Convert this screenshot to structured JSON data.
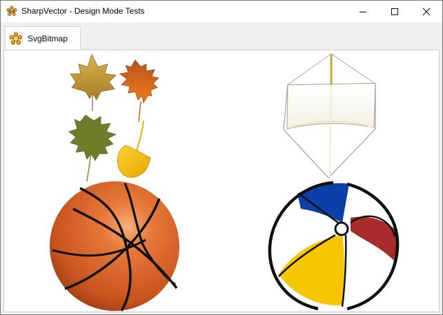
{
  "window": {
    "title": "SharpVector - Design Mode Tests",
    "title_icon": "svg-logo-icon",
    "controls": [
      "minimize-icon",
      "maximize-icon",
      "close-icon"
    ]
  },
  "tabs": [
    {
      "label": "SvgBitmap",
      "icon": "svg-logo-icon",
      "selected": true
    }
  ],
  "drawing": {
    "items": [
      "maple-leaf",
      "orange-oak-leaf",
      "green-oak-leaf",
      "yellow-leaf",
      "kite",
      "basketball",
      "beach-ball"
    ]
  },
  "colors": {
    "basketball": "#d8662a",
    "beach_blue": "#0c3fa8",
    "beach_red": "#a72b2b",
    "beach_yellow": "#f6c700",
    "leaf_gold": "#c9a13a",
    "leaf_orange": "#d6631d",
    "leaf_green": "#6f7d2a",
    "leaf_yellow": "#f3b800"
  }
}
